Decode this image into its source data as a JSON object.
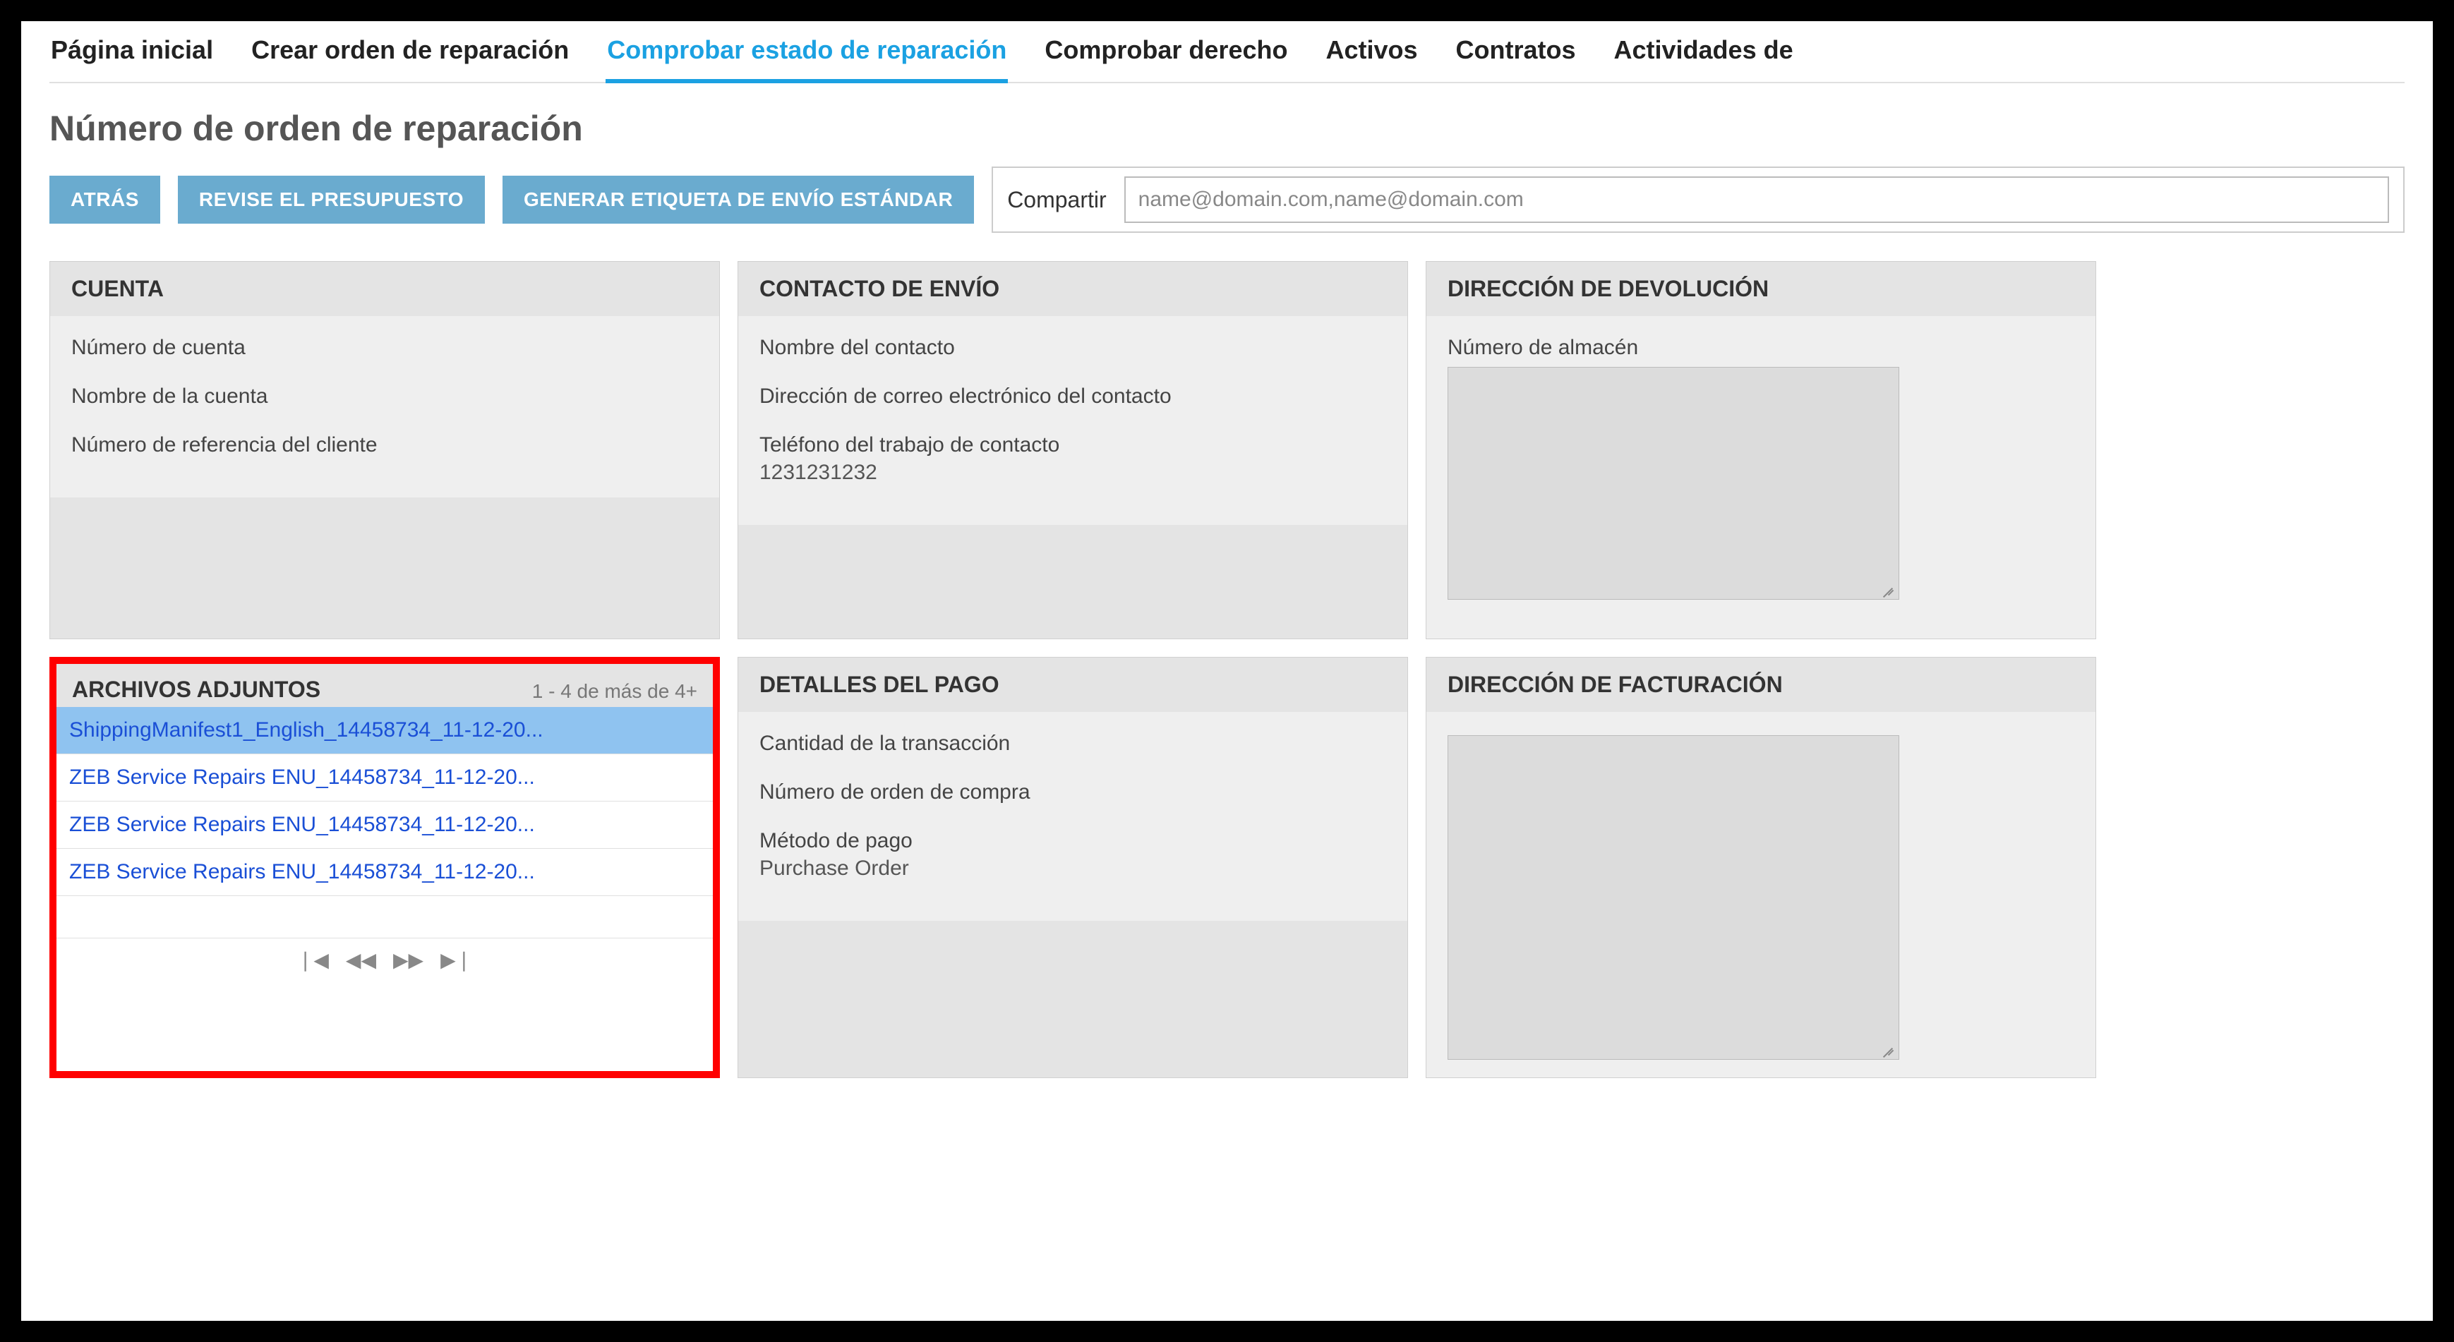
{
  "nav": {
    "items": [
      {
        "label": "Página inicial"
      },
      {
        "label": "Crear orden de reparación"
      },
      {
        "label": "Comprobar estado de reparación"
      },
      {
        "label": "Comprobar derecho"
      },
      {
        "label": "Activos"
      },
      {
        "label": "Contratos"
      },
      {
        "label": "Actividades de"
      }
    ],
    "active_index": 2
  },
  "page_title": "Número de orden de reparación",
  "actions": {
    "back": "ATRÁS",
    "review_quote": "REVISE EL PRESUPUESTO",
    "generate_label": "GENERAR ETIQUETA DE ENVÍO ESTÁNDAR"
  },
  "share": {
    "label": "Compartir",
    "placeholder": "name@domain.com,name@domain.com"
  },
  "cards": {
    "account": {
      "title": "CUENTA",
      "account_number_label": "Número de cuenta",
      "account_name_label": "Nombre de la cuenta",
      "customer_ref_label": "Número de referencia del cliente"
    },
    "shipping_contact": {
      "title": "CONTACTO DE ENVÍO",
      "contact_name_label": "Nombre del contacto",
      "contact_email_label": "Dirección de correo electrónico del contacto",
      "work_phone_label": "Teléfono del trabajo de contacto",
      "work_phone_value": "1231231232"
    },
    "return_address": {
      "title": "DIRECCIÓN DE DEVOLUCIÓN",
      "warehouse_label": "Número de almacén"
    },
    "attachments": {
      "title": "ARCHIVOS ADJUNTOS",
      "count_text": "1 - 4 de más de 4+",
      "items": [
        "ShippingManifest1_English_14458734_11-12-20...",
        "ZEB Service Repairs ENU_14458734_11-12-20...",
        "ZEB Service Repairs ENU_14458734_11-12-20...",
        "ZEB Service Repairs ENU_14458734_11-12-20..."
      ],
      "pager": {
        "first": "⏮",
        "prev": "◀◀",
        "next": "▶▶",
        "last": "⏭"
      }
    },
    "payment": {
      "title": "DETALLES DEL PAGO",
      "transaction_amount_label": "Cantidad de la transacción",
      "po_number_label": "Número de orden de compra",
      "payment_method_label": "Método de pago",
      "payment_method_value": "Purchase Order"
    },
    "billing_address": {
      "title": "DIRECCIÓN DE FACTURACIÓN"
    }
  }
}
